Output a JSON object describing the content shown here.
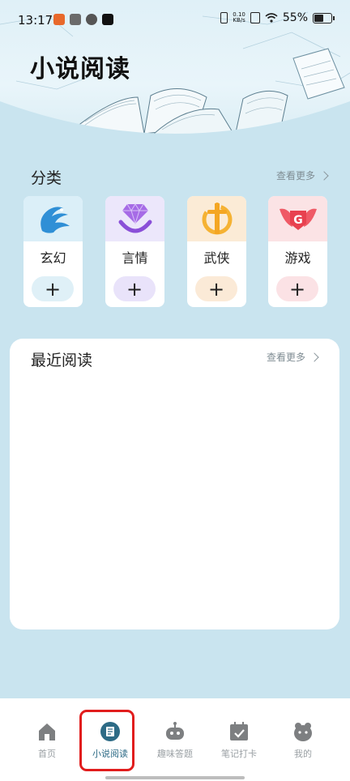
{
  "status_bar": {
    "time": "13:17",
    "net_speed_value": "0.10",
    "net_speed_unit": "KB/s",
    "battery": "55%"
  },
  "page": {
    "title": "小说阅读"
  },
  "categories_section": {
    "title": "分类",
    "more": "查看更多",
    "items": [
      {
        "label": "玄幻",
        "icon": "phoenix-icon",
        "color": "#dbeff8",
        "plus_bg": "#dff0f7"
      },
      {
        "label": "言情",
        "icon": "diamond-ring-icon",
        "color": "#ece7fb",
        "plus_bg": "#e9e3fa"
      },
      {
        "label": "武侠",
        "icon": "sword-icon",
        "color": "#fbebd6",
        "plus_bg": "#fbead7"
      },
      {
        "label": "游戏",
        "icon": "game-wings-icon",
        "color": "#fbe3e5",
        "plus_bg": "#fbe2e5"
      }
    ],
    "plus_symbol": "+"
  },
  "recent_section": {
    "title": "最近阅读",
    "more": "查看更多"
  },
  "bottom_nav": {
    "items": [
      {
        "label": "首页",
        "icon": "home-icon",
        "active": false
      },
      {
        "label": "小说阅读",
        "icon": "book-icon",
        "active": true
      },
      {
        "label": "趣味答题",
        "icon": "robot-icon",
        "active": false
      },
      {
        "label": "笔记打卡",
        "icon": "calendar-check-icon",
        "active": false
      },
      {
        "label": "我的",
        "icon": "profile-icon",
        "active": false
      }
    ]
  },
  "colors": {
    "background": "#c9e4ef",
    "accent": "#2d6b86",
    "highlight": "#e11d1d"
  }
}
